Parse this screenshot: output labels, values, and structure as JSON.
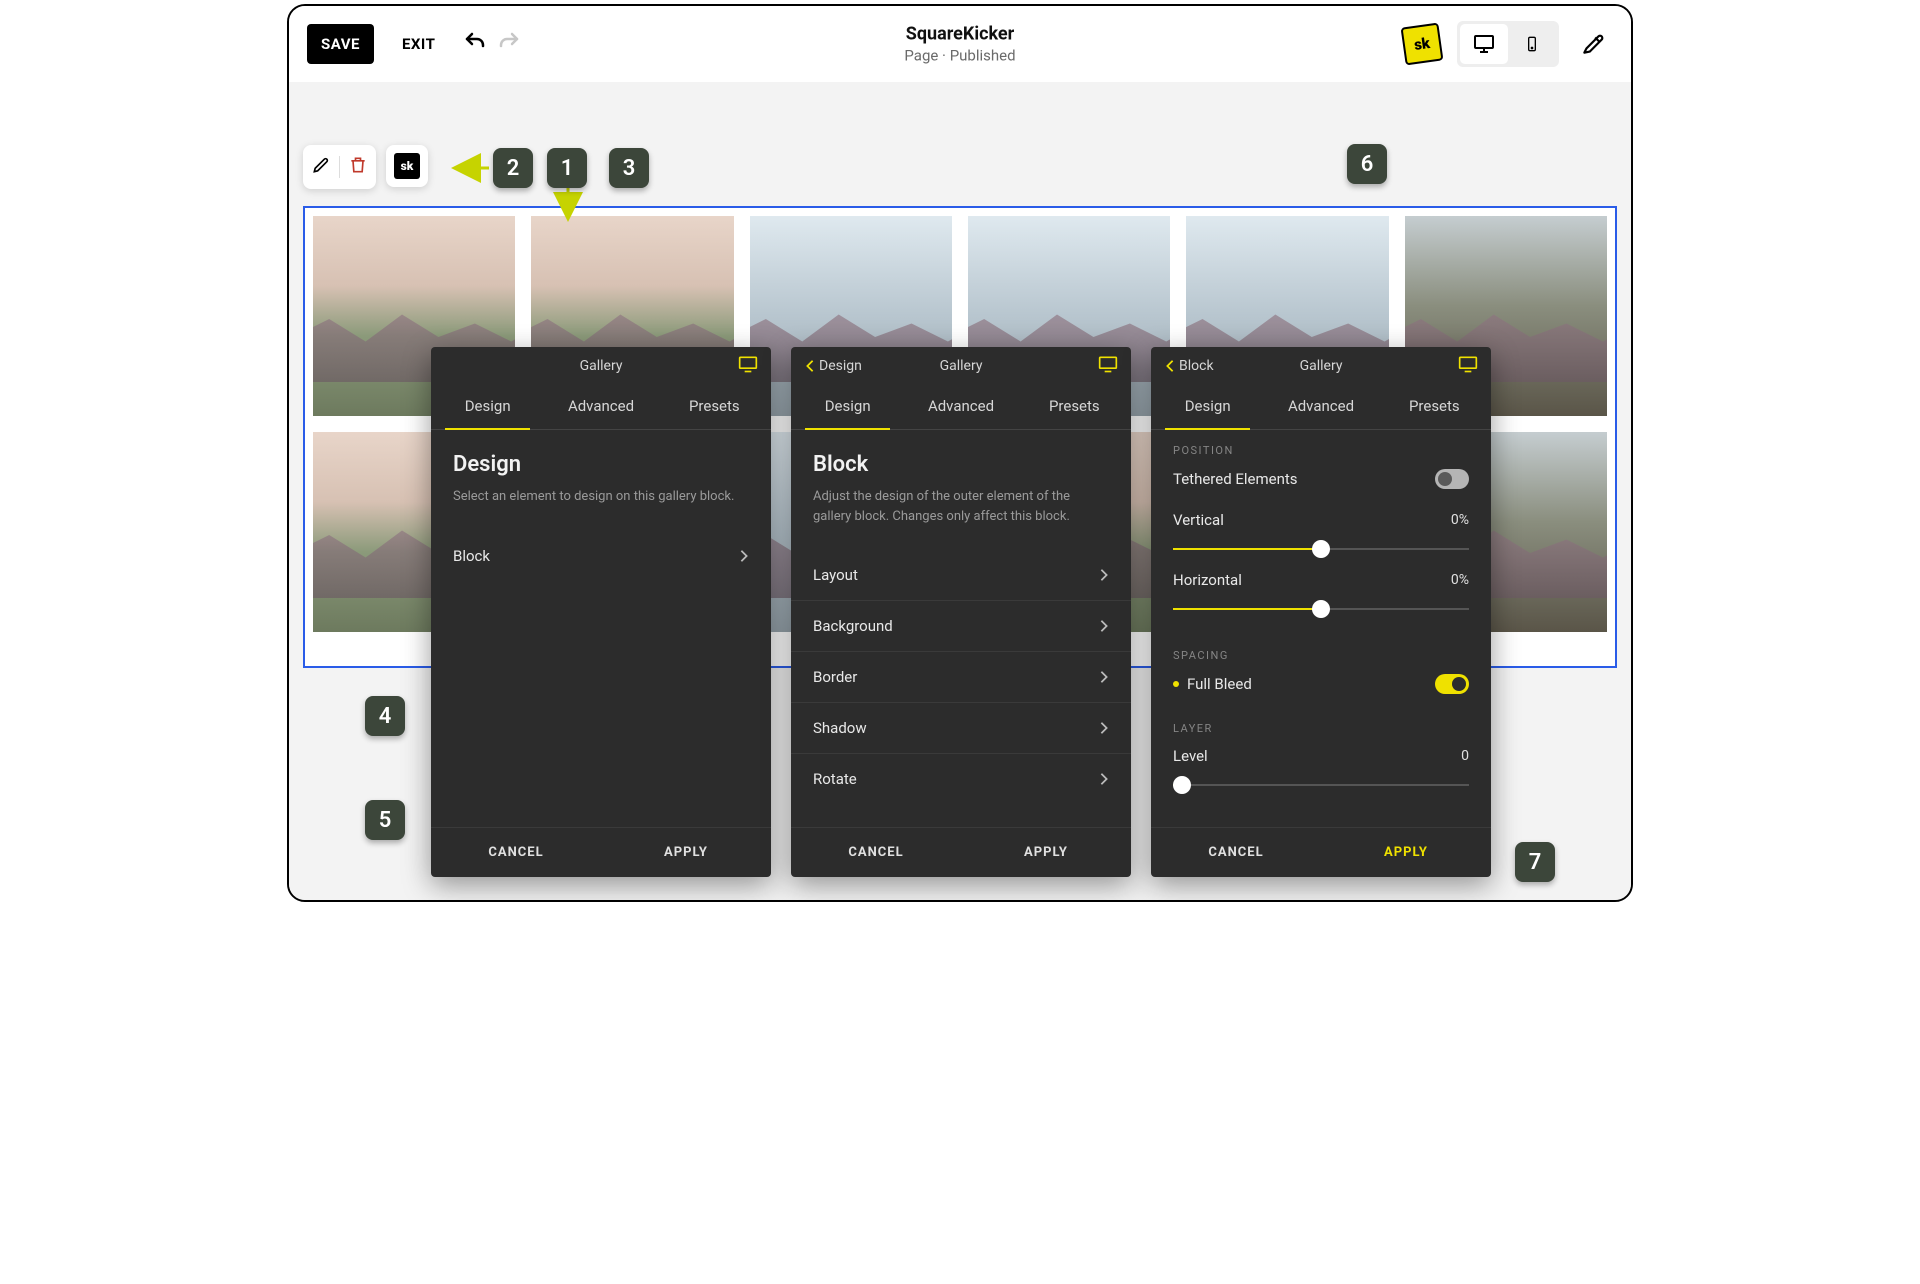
{
  "topbar": {
    "save": "SAVE",
    "exit": "EXIT",
    "title": "SquareKicker",
    "subtitle": "Page · Published",
    "sk_logo": "sk"
  },
  "block_toolbar": {
    "sk": "sk"
  },
  "panel1": {
    "header_title": "Gallery",
    "tabs": {
      "design": "Design",
      "advanced": "Advanced",
      "presets": "Presets"
    },
    "h1": "Design",
    "sub": "Select an element to design on this gallery block.",
    "items": [
      "Block"
    ],
    "cancel": "CANCEL",
    "apply": "APPLY"
  },
  "panel2": {
    "back": "Design",
    "header_title": "Gallery",
    "tabs": {
      "design": "Design",
      "advanced": "Advanced",
      "presets": "Presets"
    },
    "h1": "Block",
    "sub": "Adjust the design of the outer element of the gallery block. Changes only affect this block.",
    "items": [
      "Layout",
      "Background",
      "Border",
      "Shadow",
      "Rotate"
    ],
    "cancel": "CANCEL",
    "apply": "APPLY"
  },
  "panel3": {
    "back": "Block",
    "header_title": "Gallery",
    "tabs": {
      "design": "Design",
      "advanced": "Advanced",
      "presets": "Presets"
    },
    "position": {
      "label": "POSITION",
      "tethered": "Tethered Elements",
      "vertical": {
        "label": "Vertical",
        "value": "0%",
        "percent": 50
      },
      "horizontal": {
        "label": "Horizontal",
        "value": "0%",
        "percent": 50
      }
    },
    "spacing": {
      "label": "SPACING",
      "full_bleed": "Full Bleed"
    },
    "layer": {
      "label": "LAYER",
      "level_label": "Level",
      "level_value": "0",
      "percent": 3
    },
    "cancel": "CANCEL",
    "apply": "APPLY"
  },
  "callouts": {
    "1": "1",
    "2": "2",
    "3": "3",
    "4": "4",
    "5": "5",
    "6": "6",
    "7": "7"
  }
}
